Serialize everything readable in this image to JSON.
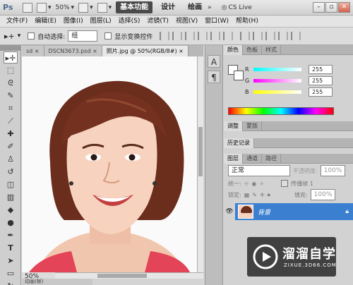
{
  "app": {
    "logo": "Ps",
    "zoom": "50%",
    "workspaces": [
      "基本功能",
      "设计",
      "绘画"
    ],
    "cs_live": "CS Live"
  },
  "menu": [
    "文件(F)",
    "编辑(E)",
    "图像(I)",
    "图层(L)",
    "选择(S)",
    "滤镜(T)",
    "视图(V)",
    "窗口(W)",
    "帮助(H)"
  ],
  "options": {
    "auto_select_label": "自动选择:",
    "auto_select_value": "组",
    "show_transform_label": "显示变换控件"
  },
  "tabs": [
    "sd",
    "DSCN3673.psd",
    "照片.jpg @ 50%(RGB/8#)"
  ],
  "tabs_close": "×",
  "status": {
    "zoom": "50%"
  },
  "bottom_tab": "动画(帧)",
  "panels": {
    "top_tabs": [
      "颜色",
      "色板",
      "样式"
    ],
    "color": {
      "channels": [
        "R",
        "G",
        "B"
      ],
      "values": [
        "255",
        "255",
        "255"
      ]
    },
    "adjust_tabs": [
      "调整",
      "蒙版"
    ],
    "history_tab": "历史记录",
    "layer_tabs": [
      "图层",
      "通道",
      "路径"
    ],
    "blend_mode": "正常",
    "opacity_label": "不透明度:",
    "opacity_value": "100%",
    "lock_label": "锁定:",
    "fill_label": "填充:",
    "fill_value": "100%",
    "unify_label": "统一:",
    "propagate_label": "传播帧 1",
    "layer_name": "背景"
  },
  "watermark": {
    "title": "溜溜自学",
    "subtitle": "ZIXUE.3D66.COM"
  },
  "colors": {
    "layer_selected": "#3a7fd0",
    "active_ws": "#4a4a4a"
  }
}
